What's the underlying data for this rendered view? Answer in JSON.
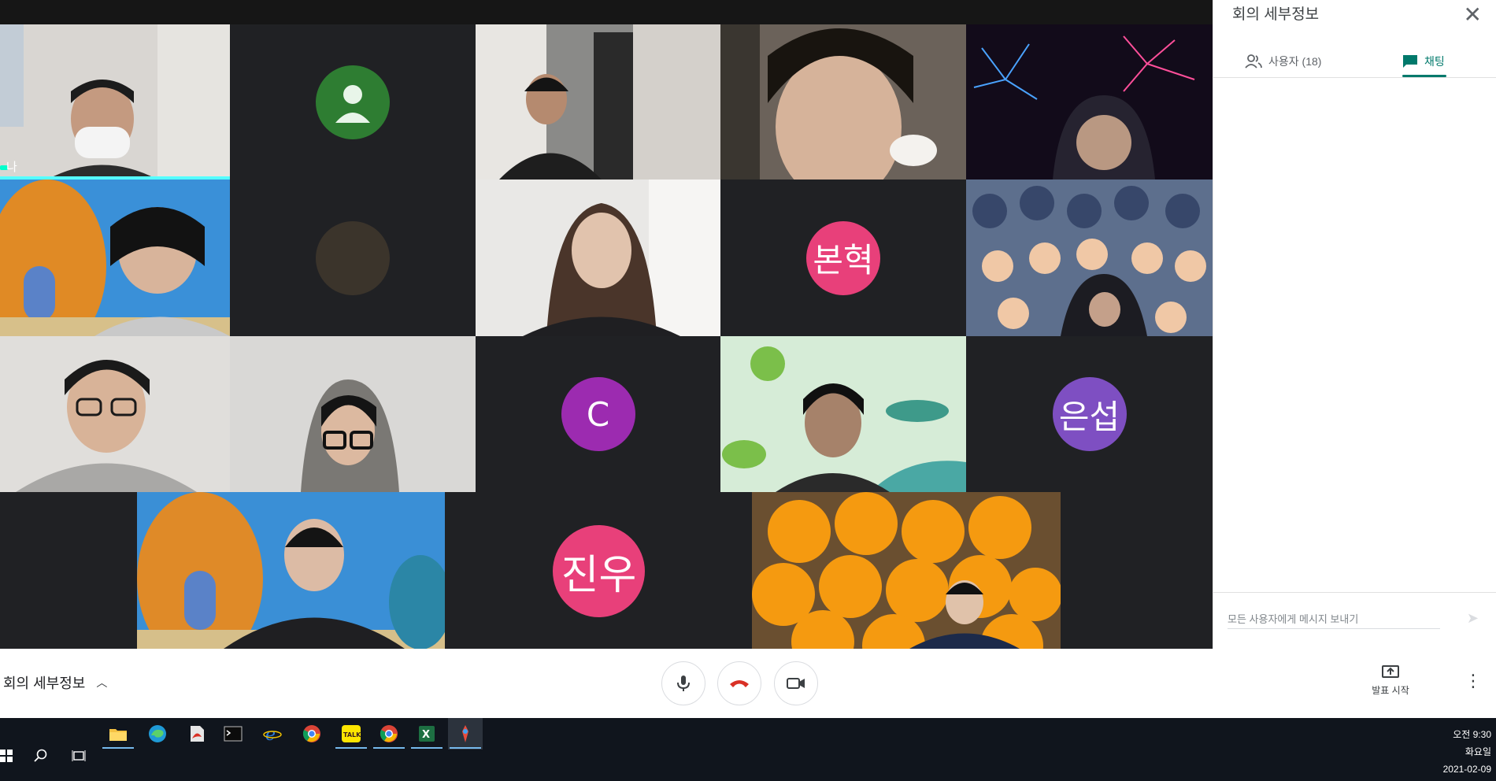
{
  "meeting": {
    "participants": [
      {
        "name": "나",
        "kind": "video",
        "scene": "masked man near whiteboard",
        "is_self": true
      },
      {
        "name": "",
        "kind": "default-avatar",
        "color": "#2e7d32"
      },
      {
        "name": "",
        "kind": "video",
        "scene": "person sitting by window"
      },
      {
        "name": "",
        "kind": "video",
        "scene": "close-up face"
      },
      {
        "name": "",
        "kind": "video",
        "scene": "fireworks background with hooded person"
      },
      {
        "name": "",
        "kind": "video",
        "scene": "pineapple house background"
      },
      {
        "name": "",
        "kind": "dim-avatar"
      },
      {
        "name": "",
        "kind": "video",
        "scene": "smiling woman white wall"
      },
      {
        "name": "본혁",
        "kind": "initial",
        "color": "#e8407a"
      },
      {
        "name": "",
        "kind": "video",
        "scene": "cartoon crowd background"
      },
      {
        "name": "",
        "kind": "video",
        "scene": "man with glasses grey hoodie"
      },
      {
        "name": "",
        "kind": "video",
        "scene": "girl with glasses hood"
      },
      {
        "name": "C",
        "kind": "initial",
        "color": "#9c2bb0"
      },
      {
        "name": "",
        "kind": "video",
        "scene": "sea creatures illustration background"
      },
      {
        "name": "은섭",
        "kind": "initial",
        "color": "#7e4fc2"
      },
      {
        "name": "",
        "kind": "video",
        "scene": "pineapple house background with girl"
      },
      {
        "name": "진우",
        "kind": "initial",
        "color": "#e8407a"
      },
      {
        "name": "",
        "kind": "video",
        "scene": "basket of tangerines"
      }
    ]
  },
  "side_panel": {
    "title": "회의 세부정보",
    "tab_people": "사용자 (18)",
    "tab_chat": "채팅",
    "message_placeholder": "모든 사용자에게 메시지 보내기",
    "accent": "#00796b"
  },
  "toolbar": {
    "meeting_details": "회의 세부정보",
    "present_label": "발표 시작",
    "hangup_color": "#d93025"
  },
  "taskbar": {
    "apps": [
      "windows-start",
      "search",
      "task-view",
      "file-explorer",
      "edge",
      "acrobat",
      "terminal",
      "internet-explorer",
      "chrome",
      "kakaotalk",
      "chrome-2",
      "excel",
      "active-app"
    ],
    "clock_ampm_time": "오전 9:30",
    "clock_day": "화요일",
    "clock_date": "2021-02-09"
  }
}
